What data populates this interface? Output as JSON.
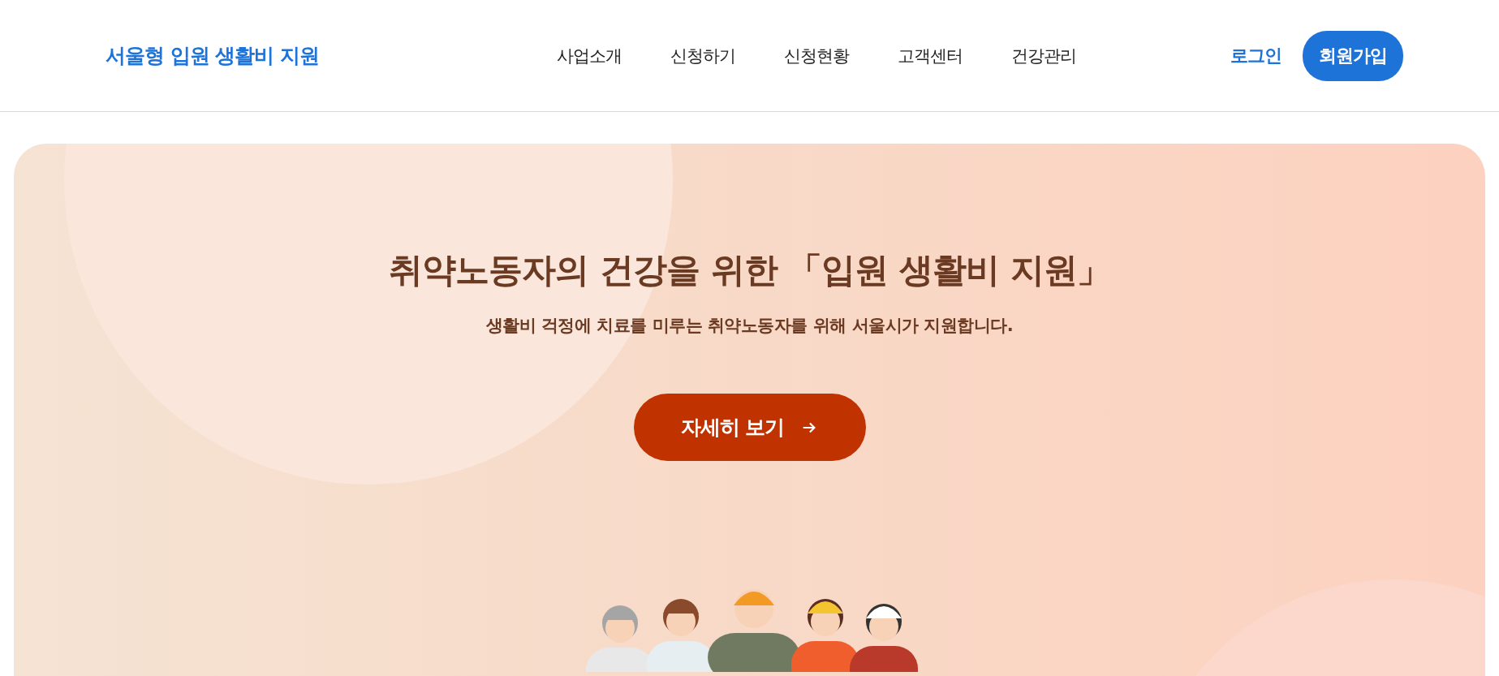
{
  "header": {
    "logo": "서울형 입원 생활비 지원",
    "nav": [
      "사업소개",
      "신청하기",
      "신청현황",
      "고객센터",
      "건강관리"
    ],
    "login": "로그인",
    "signup": "회원가입"
  },
  "hero": {
    "title": "취약노동자의 건강을 위한 「입원 생활비 지원」",
    "subtitle": "생활비 걱정에 치료를 미루는 취약노동자를 위해 서울시가 지원합니다.",
    "button": "자세히 보기"
  }
}
